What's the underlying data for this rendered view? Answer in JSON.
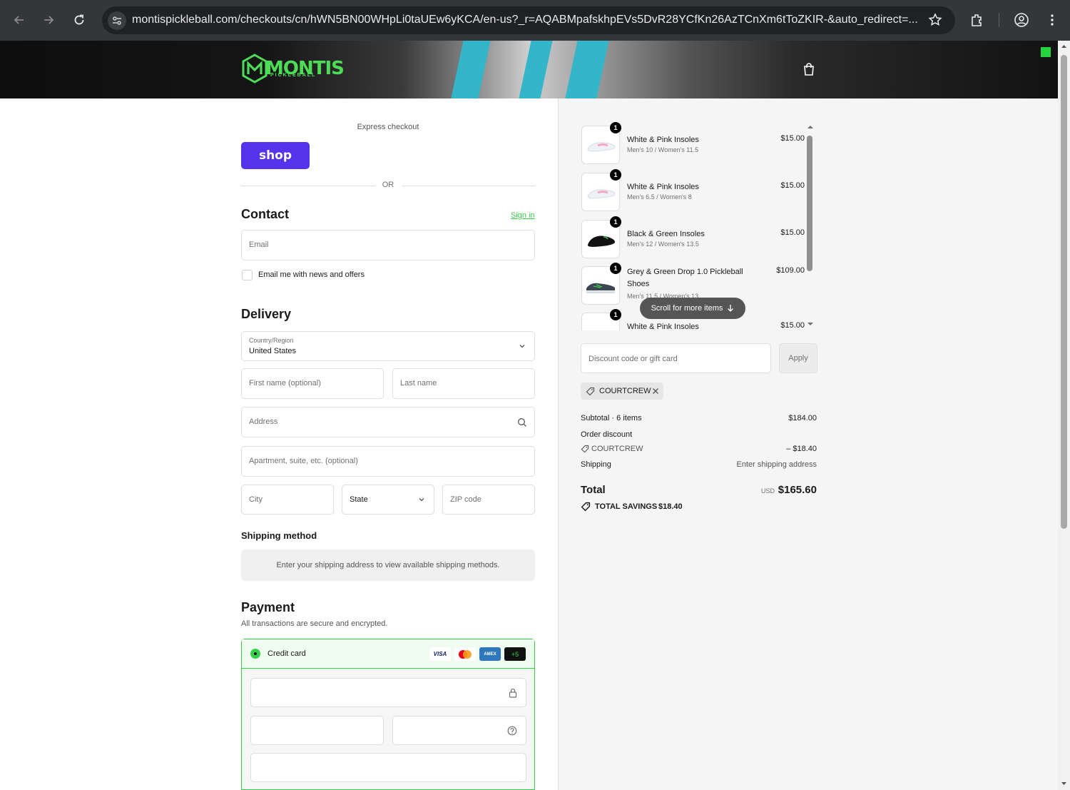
{
  "browser": {
    "url": "montispickleball.com/checkouts/cn/hWN5BN00WHpLi0taUEw6yKCA/en-us?_r=AQABMpafskhpEVs5DvR28YCfKn26AzTCnXm6tToZKIR-&auto_redirect=..."
  },
  "brand": {
    "logo_text": "MONTIS",
    "logo_sub": "PICKLEBALL",
    "accent": "#35d04a",
    "shop_pay_color": "#5433eb"
  },
  "express": {
    "label": "Express checkout",
    "shop_label": "shop",
    "or_label": "OR"
  },
  "contact": {
    "title": "Contact",
    "sign_in": "Sign in",
    "email_placeholder": "Email",
    "news_label": "Email me with news and offers"
  },
  "delivery": {
    "title": "Delivery",
    "country_label": "Country/Region",
    "country_value": "United States",
    "first_name": "First name (optional)",
    "last_name": "Last name",
    "address": "Address",
    "apartment": "Apartment, suite, etc. (optional)",
    "city": "City",
    "state": "State",
    "zip": "ZIP code"
  },
  "shipping": {
    "title": "Shipping method",
    "message": "Enter your shipping address to view available shipping methods."
  },
  "payment": {
    "title": "Payment",
    "subtitle": "All transactions are secure and encrypted.",
    "method": "Credit card",
    "cards": [
      "VISA",
      "mastercard",
      "AMEX",
      "+5"
    ]
  },
  "cart": {
    "items": [
      {
        "qty": "1",
        "name": "White & Pink Insoles",
        "variant": "Men's 10 / Women's 11.5",
        "price": "$15.00"
      },
      {
        "qty": "1",
        "name": "White & Pink Insoles",
        "variant": "Men's 6.5 / Women's 8",
        "price": "$15.00"
      },
      {
        "qty": "1",
        "name": "Black & Green Insoles",
        "variant": "Men's 12 / Women's 13.5",
        "price": "$15.00"
      },
      {
        "qty": "1",
        "name": "Grey & Green Drop 1.0 Pickleball Shoes",
        "variant": "Men's 11.5 / Women's 13",
        "price": "$109.00"
      },
      {
        "qty": "1",
        "name": "White & Pink Insoles",
        "variant": "",
        "price": "$15.00"
      }
    ],
    "scroll_hint": "Scroll for more items"
  },
  "discount": {
    "placeholder": "Discount code or gift card",
    "apply": "Apply",
    "applied_code": "COURTCREW"
  },
  "summary": {
    "subtotal_label": "Subtotal · 6 items",
    "subtotal_value": "$184.00",
    "order_discount_label": "Order discount",
    "discount_code": "COURTCREW",
    "discount_value": "– $18.40",
    "shipping_label": "Shipping",
    "shipping_value": "Enter shipping address",
    "total_label": "Total",
    "currency": "USD",
    "total_value": "$165.60",
    "savings_label": "TOTAL SAVINGS",
    "savings_value": "$18.40"
  }
}
